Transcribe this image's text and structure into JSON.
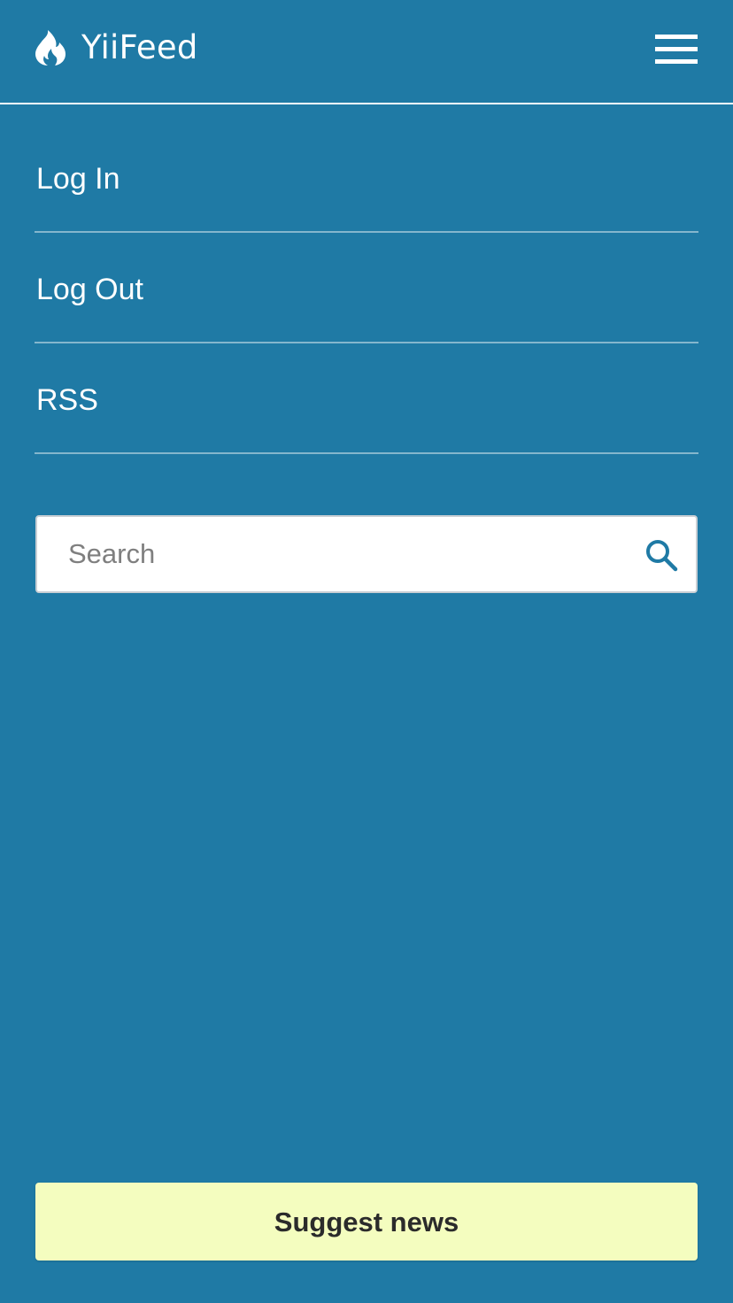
{
  "header": {
    "brand": "YiiFeed",
    "logo_icon": "flame-icon",
    "menu_icon": "hamburger-menu-icon"
  },
  "nav": {
    "items": [
      {
        "label": "Log In"
      },
      {
        "label": "Log Out"
      },
      {
        "label": "RSS"
      }
    ]
  },
  "search": {
    "placeholder": "Search",
    "value": "",
    "icon": "search-icon"
  },
  "footer": {
    "suggest_label": "Suggest news"
  },
  "colors": {
    "background": "#1f7aa5",
    "text": "#ffffff",
    "suggest_button_bg": "#f4fdbf",
    "search_icon": "#1f7aa5"
  }
}
